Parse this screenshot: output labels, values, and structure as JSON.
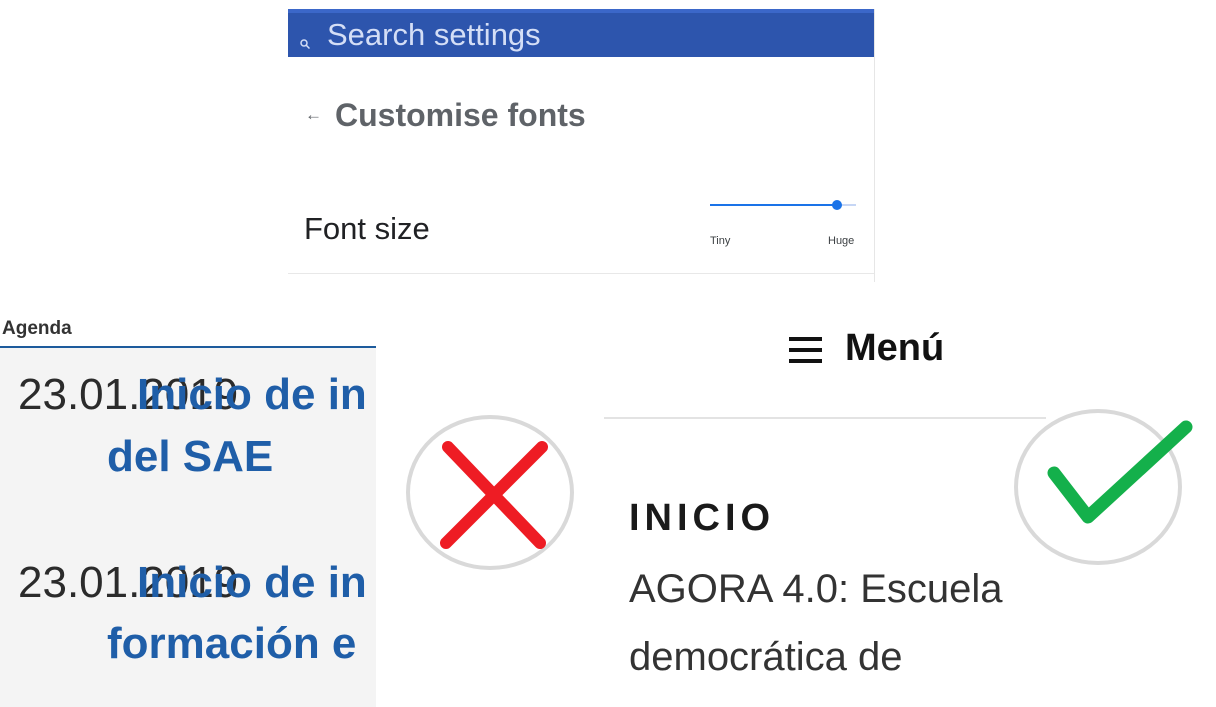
{
  "settings": {
    "search_placeholder": "Search settings",
    "back_icon": "arrow-back-icon",
    "title": "Customise fonts",
    "font_size_label": "Font size",
    "slider": {
      "min_label": "Tiny",
      "max_label": "Huge",
      "value_fraction": 0.87
    },
    "colors": {
      "search_bar": "#2d55ad",
      "accent": "#1a73e8"
    }
  },
  "agenda": {
    "title": "Agenda",
    "items": [
      {
        "date": "23.01.2019",
        "title_line1": "Inicio de in",
        "title_line2": "del SAE"
      },
      {
        "date": "23.01.2019",
        "title_line1": "Inicio de in",
        "title_line2": "formación e"
      }
    ],
    "colors": {
      "link": "#1f5ea8",
      "background": "#f4f4f4"
    }
  },
  "marks": {
    "wrong_icon": "red-cross-icon",
    "right_icon": "green-checkmark-icon",
    "colors": {
      "wrong": "#ee1c24",
      "right": "#14b04b"
    }
  },
  "menu": {
    "icon": "hamburger-menu-icon",
    "label": "Menú",
    "section": "INICIO",
    "entry_lines": [
      "AGORA 4.0: Escuela",
      "democrática de"
    ]
  }
}
